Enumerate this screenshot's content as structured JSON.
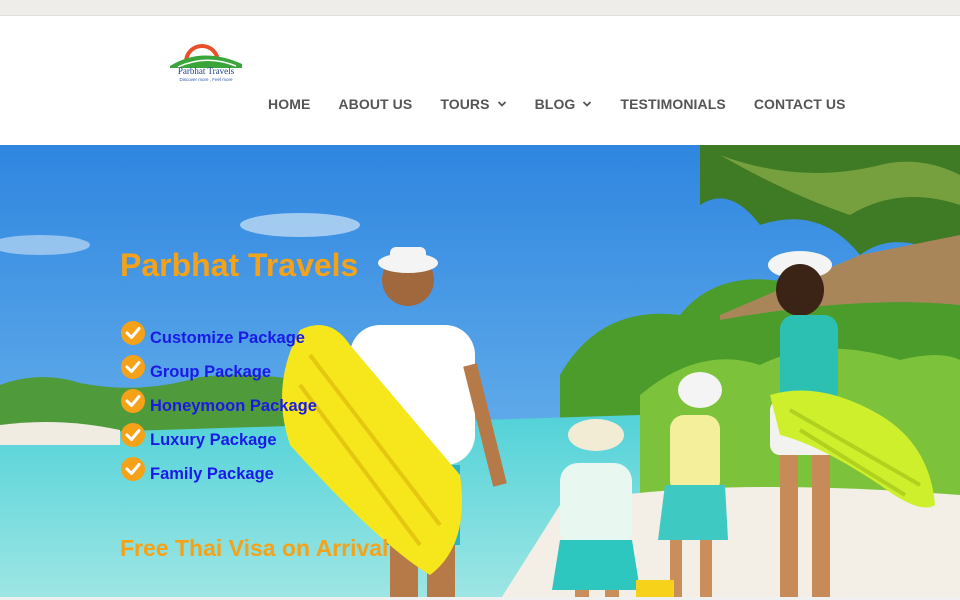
{
  "header": {
    "logo": {
      "brand": "Parbhat Travels",
      "tagline": "Discover more , Feel more"
    },
    "nav": [
      {
        "label": "HOME",
        "has_dropdown": false
      },
      {
        "label": "ABOUT US",
        "has_dropdown": false
      },
      {
        "label": "TOURS",
        "has_dropdown": true
      },
      {
        "label": "BLOG",
        "has_dropdown": true
      },
      {
        "label": "TESTIMONIALS",
        "has_dropdown": false
      },
      {
        "label": "CONTACT US",
        "has_dropdown": false
      }
    ]
  },
  "hero": {
    "title": "Parbhat Travels",
    "packages": [
      "Customize Package",
      "Group Package",
      "Honeymoon Package",
      "Luxury Package",
      "Family Package"
    ],
    "visa_text": "Free Thai Visa on Arrival"
  },
  "colors": {
    "accent_orange": "#f5a218",
    "package_blue": "#1a1ae6",
    "nav_text": "#555555"
  },
  "icons": {
    "package_bullet": "check-circle-icon",
    "dropdown": "chevron-down-icon"
  }
}
